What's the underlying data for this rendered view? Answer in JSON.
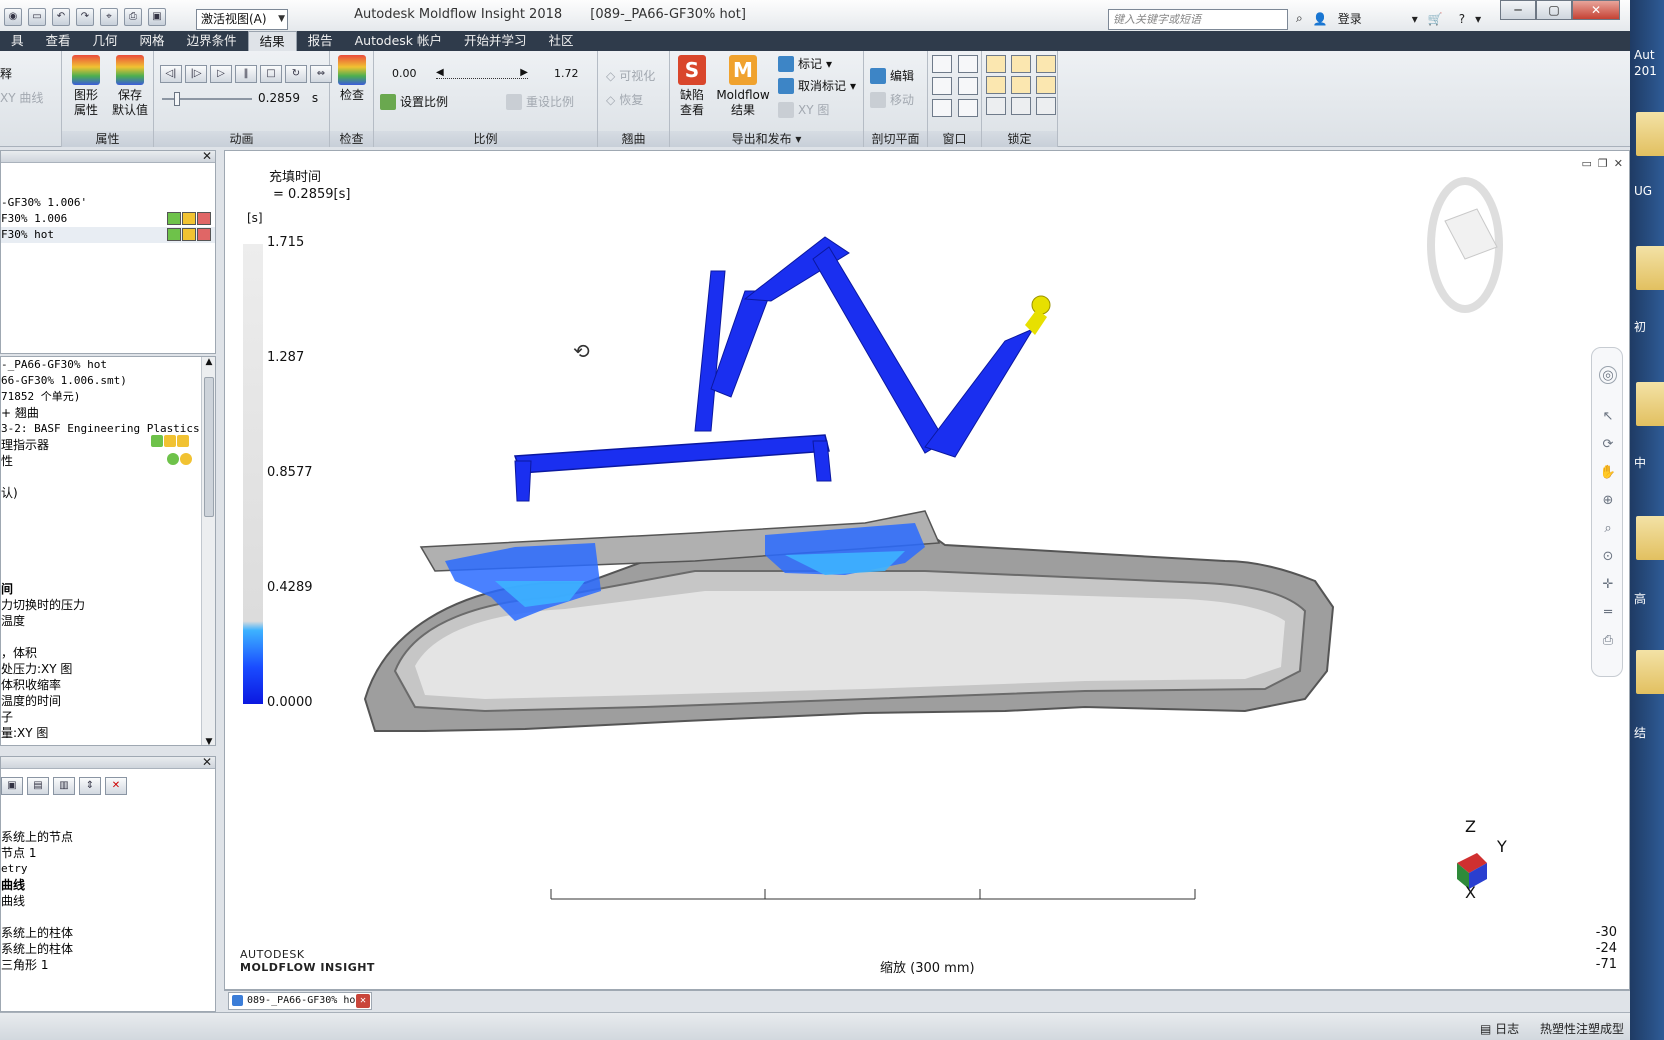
{
  "title": {
    "app": "Autodesk Moldflow Insight 2018",
    "doc": "[089-_PA66-GF30% hot]",
    "view_select": "激活视图(A)",
    "search_placeholder": "键入关键字或短语",
    "login": "登录"
  },
  "menu": [
    "具",
    "查看",
    "几何",
    "网格",
    "边界条件",
    "结果",
    "报告",
    "Autodesk 帐户",
    "开始并学习",
    "社区"
  ],
  "ribbon": {
    "partial_label": "释",
    "xy_curve": "XY 曲线",
    "graph_props": "图形\n属性",
    "save_default": "保存\n默认值",
    "group_props": "属性",
    "anim_time": "0.2859",
    "anim_unit": "s",
    "group_anim": "动画",
    "inspect": "检查",
    "group_inspect": "检查",
    "scale_min": "0.00",
    "scale_max": "1.72",
    "set_scale": "设置比例",
    "reset_scale": "重设比例",
    "group_scale": "比例",
    "visualize": "可视化",
    "restore": "恢复",
    "group_warp": "翘曲",
    "defect_view": "缺陷\n查看",
    "moldflow_result": "Moldflow\n结果",
    "mark": "标记",
    "unmark": "取消标记",
    "xy_plot": "XY 图",
    "group_export": "导出和发布",
    "edit": "编辑",
    "move": "移动",
    "group_section": "剖切平面",
    "group_window": "窗口",
    "group_lock": "锁定"
  },
  "study_list": [
    {
      "name": "-GF30% 1.006'",
      "selected": false
    },
    {
      "name": "F30% 1.006",
      "selected": false
    },
    {
      "name": "F30% hot",
      "selected": true
    }
  ],
  "task_items": [
    "-_PA66-GF30% hot",
    "66-GF30% 1.006.smt)",
    "71852 个单元)",
    "+ 翘曲",
    "3-2: BASF Engineering Plastics",
    "理指示器",
    "性",
    "",
    "认)",
    "",
    "",
    "",
    "",
    "间",
    "力切换时的压力",
    "温度",
    "",
    "，体积",
    "处压力:XY 图",
    "体积收缩率",
    "温度的时间",
    "子",
    "量:XY 图"
  ],
  "layers": [
    "系统上的节点",
    "节点 1",
    "etry",
    "曲线",
    "曲线",
    "",
    "系统上的柱体",
    "系统上的柱体",
    "三角形 1"
  ],
  "viewport": {
    "legend_title": "充填时间",
    "legend_value": "= 0.2859[s]",
    "legend_unit": "[s]",
    "ticks": [
      "1.715",
      "1.287",
      "0.8577",
      "0.4289",
      "0.0000"
    ],
    "brand_top": "AUTODESK",
    "brand_bottom": "MOLDFLOW INSIGHT",
    "scale_text": "缩放 (300 mm)",
    "coords": [
      "-30",
      "-24",
      "-71"
    ],
    "axis_z": "Z",
    "axis_y": "Y",
    "axis_x": "X"
  },
  "doc_tab": "089-_PA66-GF30% hot",
  "status": {
    "log": "日志",
    "mode": "热塑性注塑成型"
  },
  "desktop": [
    "Aut",
    "201",
    "UG",
    "初",
    "中",
    "高",
    "结"
  ],
  "colors": {
    "accent_blue": "#0b18e0",
    "fill_cyan": "#3db2ff"
  }
}
